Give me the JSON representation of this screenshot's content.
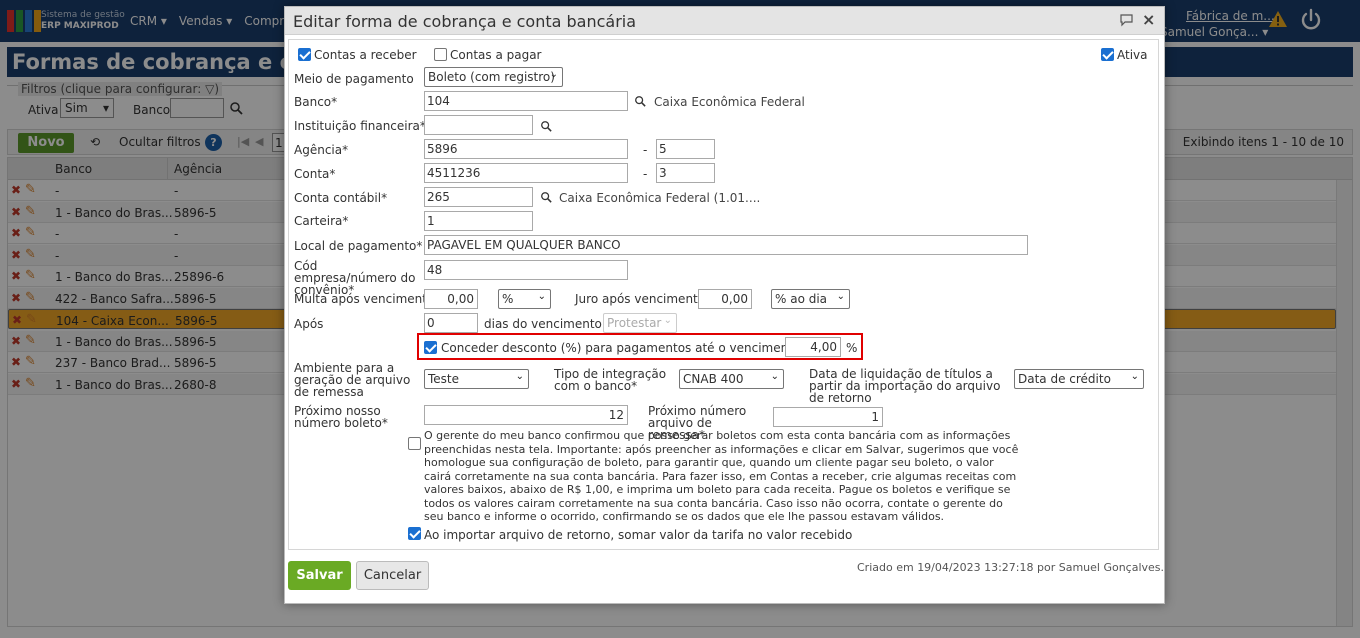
{
  "app": {
    "brand_line1": "Sistema de gestão",
    "brand_line2": "ERP MAXIPROD",
    "nav": [
      "CRM ▾",
      "Vendas ▾",
      "Compra"
    ],
    "company": "Fábrica de m...",
    "user": "Samuel Gonça... ▾"
  },
  "page": {
    "title": "Formas de cobrança e co",
    "filters_legend": "Filtros (clique para configurar:",
    "filter_ativa_label": "Ativa",
    "filter_ativa_value": "Sim",
    "filter_banco_label": "Banco",
    "btn_novo": "Novo",
    "hide_filters": "Ocultar filtros",
    "page_number": "1",
    "showing": "Exibindo itens 1 - 10 de 10",
    "columns": [
      "Banco",
      "Agência"
    ],
    "rows": [
      {
        "banco": "-",
        "agencia": "-"
      },
      {
        "banco": "1 - Banco do Bras...",
        "agencia": "5896-5"
      },
      {
        "banco": "-",
        "agencia": "-"
      },
      {
        "banco": "-",
        "agencia": "-"
      },
      {
        "banco": "1 - Banco do Bras...",
        "agencia": "25896-6"
      },
      {
        "banco": "422 - Banco Safra...",
        "agencia": "5896-5"
      },
      {
        "banco": "104 - Caixa Econ...",
        "agencia": "5896-5"
      },
      {
        "banco": "1 - Banco do Bras...",
        "agencia": "5896-5"
      },
      {
        "banco": "237 - Banco Brad...",
        "agencia": "5896-5"
      },
      {
        "banco": "1 - Banco do Bras...",
        "agencia": "2680-8"
      }
    ]
  },
  "modal": {
    "title": "Editar forma de cobrança e conta bancária",
    "contas_receber": "Contas a receber",
    "contas_pagar": "Contas a pagar",
    "ativa": "Ativa",
    "meio_pagamento_label": "Meio de pagamento",
    "meio_pagamento_value": "Boleto (com registro)",
    "banco_label": "Banco*",
    "banco_value": "104",
    "banco_name": "Caixa Econômica Federal",
    "instituicao_label": "Instituição financeira*",
    "instituicao_value": "",
    "agencia_label": "Agência*",
    "agencia_value": "5896",
    "agencia_dv": "5",
    "conta_label": "Conta*",
    "conta_value": "4511236",
    "conta_dv": "3",
    "dash": "-",
    "conta_contabil_label": "Conta contábil*",
    "conta_contabil_value": "265",
    "conta_contabil_name": "Caixa Econômica Federal (1.01....",
    "carteira_label": "Carteira*",
    "carteira_value": "1",
    "local_pagamento_label": "Local de pagamento*",
    "local_pagamento_value": "PAGAVEL EM QUALQUER BANCO",
    "cod_empresa_label": "Cód empresa/número do convênio*",
    "cod_empresa_value": "48",
    "multa_label": "Multa após vencimento",
    "multa_value": "0,00",
    "multa_unit": "%",
    "juro_label": "Juro após vencimento",
    "juro_value": "0,00",
    "juro_unit": "% ao dia",
    "apos_label": "Após",
    "apos_value": "0",
    "dias_label": "dias do vencimento",
    "protestar_value": "Protestar",
    "desconto_label": "Conceder desconto (%) para pagamentos até o vencimento",
    "desconto_value": "4,00",
    "desconto_unit": "%",
    "ambiente_label": "Ambiente para a geração de arquivo de remessa",
    "ambiente_value": "Teste",
    "tipo_integracao_label": "Tipo de integração com o banco*",
    "tipo_integracao_value": "CNAB 400",
    "data_liquidacao_label": "Data de liquidação de títulos a partir da importação do arquivo de retorno",
    "data_liquidacao_value": "Data de crédito",
    "proximo_nosso_label": "Próximo nosso número boleto*",
    "proximo_nosso_value": "12",
    "proximo_remessa_label": "Próximo número arquivo de remessa*",
    "proximo_remessa_value": "1",
    "confirm_text": "O gerente do meu banco confirmou que posso gerar boletos com esta conta bancária com as informações preenchidas nesta tela. Importante: após preencher as informações e clicar em Salvar, sugerimos que você homologue sua configuração de boleto, para garantir que, quando um cliente pagar seu boleto, o valor cairá corretamente na sua conta bancária. Para fazer isso, em Contas a receber, crie algumas receitas com valores baixos, abaixo de R$ 1,00, e imprima um boleto para cada receita. Pague os boletos e verifique se todos os valores cairam corretamente na sua conta bancária. Caso isso não ocorra, contate o gerente do seu banco e informe o ocorrido, confirmando se os dados que ele lhe passou estavam válidos.",
    "tarifa_label": "Ao importar arquivo de retorno, somar valor da tarifa no valor recebido",
    "btn_salvar": "Salvar",
    "btn_cancelar": "Cancelar",
    "created": "Criado em 19/04/2023 13:27:18 por Samuel Gonçalves."
  },
  "colors": {
    "nav_bg": "#1b3f6e",
    "save_green": "#6aaa24",
    "highlight_red": "#e00000",
    "selected_row": "#f3a827"
  }
}
